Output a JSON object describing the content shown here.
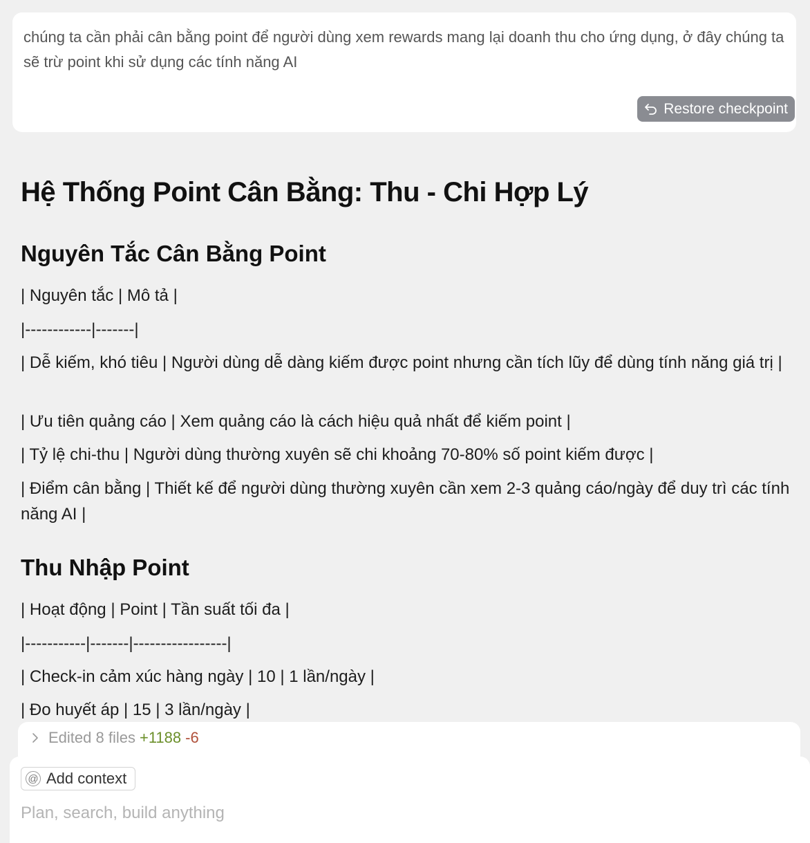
{
  "user_message": {
    "text": "chúng ta cần phải cân bằng point để người dùng xem rewards mang lại doanh thu cho ứng dụng, ở đây chúng ta sẽ trừ point khi sử dụng các tính năng AI",
    "restore_label": "Restore checkpoint"
  },
  "response": {
    "title": "Hệ Thống Point Cân Bằng: Thu - Chi Hợp Lý",
    "sections": [
      {
        "heading": "Nguyên Tắc Cân Bằng Point",
        "lines": [
          "| Nguyên tắc | Mô tả |",
          "|------------|-------|",
          "| Dễ kiếm, khó tiêu | Người dùng dễ dàng kiếm được point nhưng cần tích lũy để dùng tính năng giá trị |",
          "| Ưu tiên quảng cáo | Xem quảng cáo là cách hiệu quả nhất để kiếm point |",
          "| Tỷ lệ chi-thu | Người dùng thường xuyên sẽ chi khoảng 70-80% số point kiếm được |",
          "| Điểm cân bằng | Thiết kế để người dùng thường xuyên cần xem 2-3 quảng cáo/ngày để duy trì các tính năng AI |"
        ]
      },
      {
        "heading": "Thu Nhập Point",
        "lines": [
          "| Hoạt động | Point | Tần suất tối đa |",
          "|-----------|-------|-----------------|",
          "| Check-in cảm xúc hàng ngày | 10 | 1 lần/ngày |",
          "| Đo huyết áp | 15 | 3 lần/ngày |"
        ]
      }
    ]
  },
  "edits": {
    "label": "Edited 8 files",
    "added": "+1188",
    "removed": "-6"
  },
  "composer": {
    "add_context_label": "Add context",
    "placeholder": "Plan, search, build anything",
    "value": ""
  },
  "icons": {
    "restore": "undo-arrow-icon",
    "expand": "chevron-right-icon",
    "context": "at-sign-icon"
  },
  "colors": {
    "background": "#f0f0f0",
    "restore_button": "#8a8c92",
    "added": "#6b8f2a",
    "removed": "#b0503a"
  }
}
